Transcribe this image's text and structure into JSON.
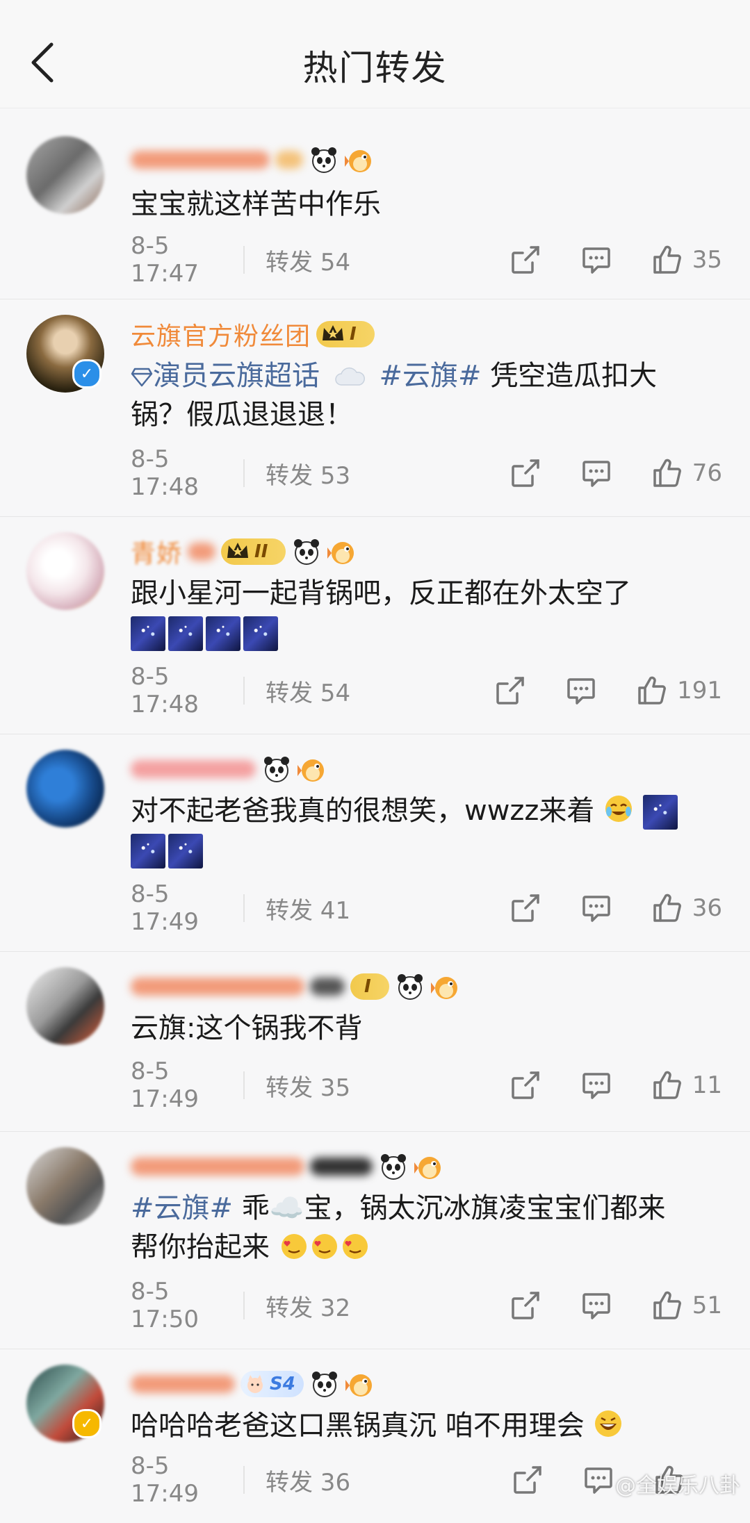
{
  "header": {
    "title": "热门转发"
  },
  "items": [
    {
      "name_visible": "",
      "content": "宝宝就这样苦中作乐",
      "time": "8-5 17:47",
      "repost": "转发 54",
      "likes": "35"
    },
    {
      "name_visible": "云旗官方粉丝团",
      "badge": "I",
      "content_tag": "演员云旗超话",
      "content_tag2": "#云旗#",
      "content_rest_line1": "凭空造瓜扣大",
      "content_line2": "锅？假瓜退退退！",
      "time": "8-5 17:48",
      "repost": "转发 53",
      "likes": "76"
    },
    {
      "name_visible": "青娇",
      "badge": "II",
      "content": "跟小星河一起背锅吧，反正都在外太空了",
      "time": "8-5 17:48",
      "repost": "转发 54",
      "likes": "191"
    },
    {
      "name_visible": "",
      "content": "对不起老爸我真的很想笑，wwzz来着",
      "time": "8-5 17:49",
      "repost": "转发 41",
      "likes": "36"
    },
    {
      "name_visible": "",
      "badge": "I",
      "content": "云旗:这个锅我不背",
      "time": "8-5 17:49",
      "repost": "转发 35",
      "likes": "11"
    },
    {
      "name_visible": "",
      "content_tag": "#云旗#",
      "content_rest_line1": "乖☁️宝，锅太沉冰旗凌宝宝们都来",
      "content_line2": "帮你抬起来",
      "time": "8-5 17:50",
      "repost": "转发 32",
      "likes": "51"
    },
    {
      "name_visible": "",
      "badge": "S4",
      "content": "哈哈哈老爸这口黑锅真沉 咱不用理会",
      "time": "8-5 17:49",
      "repost": "转发 36",
      "likes": ""
    }
  ],
  "watermark": "@全娱乐八卦"
}
